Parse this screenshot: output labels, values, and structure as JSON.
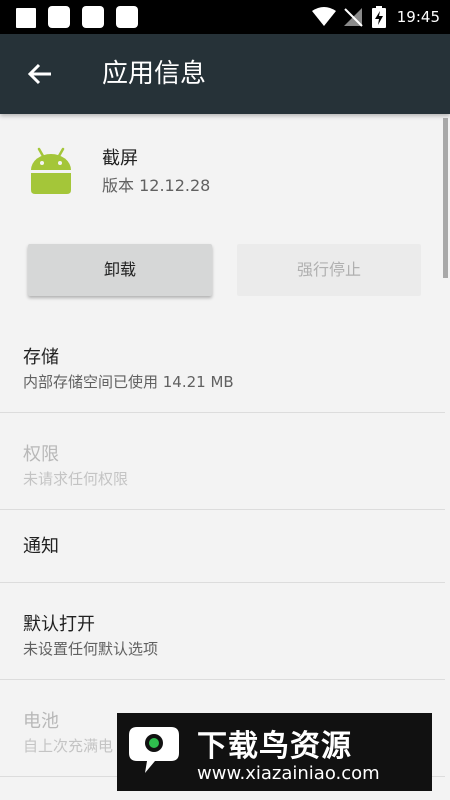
{
  "status_bar": {
    "time": "19:45",
    "icons": [
      "notification-icon",
      "notification-icon",
      "notification-icon",
      "notification-icon",
      "wifi-icon",
      "no-signal-icon",
      "battery-charging-icon"
    ]
  },
  "app_bar": {
    "title": "应用信息",
    "back_icon": "arrow-back-icon",
    "background_color": "#263238"
  },
  "app": {
    "name": "截屏",
    "version": "版本 12.12.28",
    "icon": "android-robot-icon",
    "icon_color": "#a4c639"
  },
  "actions": {
    "uninstall_label": "卸载",
    "force_stop_label": "强行停止"
  },
  "settings": {
    "storage": {
      "title": "存储",
      "subtitle": "内部存储空间已使用 14.21 MB"
    },
    "permissions": {
      "title": "权限",
      "subtitle": "未请求任何权限"
    },
    "notifications": {
      "title": "通知"
    },
    "open_by_default": {
      "title": "默认打开",
      "subtitle": "未设置任何默认选项"
    },
    "battery": {
      "title": "电池",
      "subtitle": "自上次充满电"
    }
  },
  "watermark": {
    "name": "下载鸟资源",
    "url": "www.xiazainiao.com",
    "accent_color": "#2fbf4e"
  }
}
